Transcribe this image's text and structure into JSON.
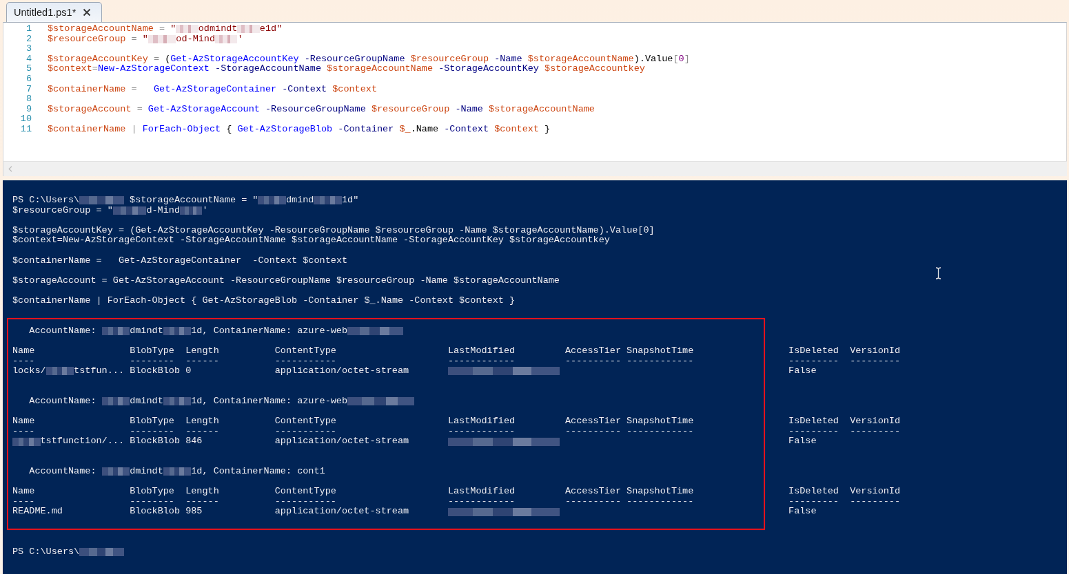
{
  "tabs": [
    {
      "label": "Untitled1.ps1*",
      "selected": true
    }
  ],
  "editor": {
    "lines": [
      {
        "number": "1",
        "tokens": [
          {
            "kind": "variable",
            "text": "$storageAccountName"
          },
          {
            "kind": "operator",
            "text": " = "
          },
          {
            "kind": "string",
            "text": "\""
          },
          {
            "kind": "redacted"
          },
          {
            "kind": "string",
            "text": "odmindt"
          },
          {
            "kind": "redacted"
          },
          {
            "kind": "string",
            "text": "e1d\""
          }
        ]
      },
      {
        "number": "2",
        "tokens": [
          {
            "kind": "variable",
            "text": "$resourceGroup"
          },
          {
            "kind": "operator",
            "text": " = "
          },
          {
            "kind": "string",
            "text": "\""
          },
          {
            "kind": "redacted"
          },
          {
            "kind": "string",
            "text": "od-Mind"
          },
          {
            "kind": "redacted"
          },
          {
            "kind": "string",
            "text": "'"
          }
        ]
      },
      {
        "number": "3"
      },
      {
        "number": "4",
        "tokens": [
          {
            "kind": "variable",
            "text": "$storageAccountKey"
          },
          {
            "kind": "operator",
            "text": " = "
          },
          {
            "kind": "plain",
            "text": "("
          },
          {
            "kind": "command",
            "text": "Get-AzStorageAccountKey"
          },
          {
            "kind": "parameter",
            "text": " -ResourceGroupName "
          },
          {
            "kind": "variable",
            "text": "$resourceGroup"
          },
          {
            "kind": "parameter",
            "text": " -Name "
          },
          {
            "kind": "variable",
            "text": "$storageAccountName"
          },
          {
            "kind": "plain",
            "text": ").Value"
          },
          {
            "kind": "operator",
            "text": "["
          },
          {
            "kind": "number",
            "text": "0"
          },
          {
            "kind": "operator",
            "text": "]"
          }
        ]
      },
      {
        "number": "5",
        "tokens": [
          {
            "kind": "variable",
            "text": "$context"
          },
          {
            "kind": "operator",
            "text": "="
          },
          {
            "kind": "command",
            "text": "New-AzStorageContext"
          },
          {
            "kind": "parameter",
            "text": " -StorageAccountName "
          },
          {
            "kind": "variable",
            "text": "$storageAccountName"
          },
          {
            "kind": "parameter",
            "text": " -StorageAccountKey "
          },
          {
            "kind": "variable",
            "text": "$storageAccountkey"
          }
        ]
      },
      {
        "number": "6"
      },
      {
        "number": "7",
        "tokens": [
          {
            "kind": "variable",
            "text": "$containerName"
          },
          {
            "kind": "operator",
            "text": " =   "
          },
          {
            "kind": "command",
            "text": "Get-AzStorageContainer"
          },
          {
            "kind": "parameter",
            "text": " -Context "
          },
          {
            "kind": "variable",
            "text": "$context"
          }
        ]
      },
      {
        "number": "8"
      },
      {
        "number": "9",
        "tokens": [
          {
            "kind": "variable",
            "text": "$storageAccount"
          },
          {
            "kind": "operator",
            "text": " = "
          },
          {
            "kind": "command",
            "text": "Get-AzStorageAccount"
          },
          {
            "kind": "parameter",
            "text": " -ResourceGroupName "
          },
          {
            "kind": "variable",
            "text": "$resourceGroup"
          },
          {
            "kind": "parameter",
            "text": " -Name "
          },
          {
            "kind": "variable",
            "text": "$storageAccountName"
          }
        ]
      },
      {
        "number": "10"
      },
      {
        "number": "11",
        "tokens": [
          {
            "kind": "variable",
            "text": "$containerName"
          },
          {
            "kind": "operator",
            "text": " | "
          },
          {
            "kind": "command",
            "text": "ForEach-Object"
          },
          {
            "kind": "plain",
            "text": " { "
          },
          {
            "kind": "command",
            "text": "Get-AzStorageBlob"
          },
          {
            "kind": "parameter",
            "text": " -Container "
          },
          {
            "kind": "variable",
            "text": "$_"
          },
          {
            "kind": "plain",
            "text": ".Name"
          },
          {
            "kind": "parameter",
            "text": " -Context "
          },
          {
            "kind": "variable",
            "text": "$context"
          },
          {
            "kind": "plain",
            "text": " }"
          }
        ]
      }
    ]
  },
  "console": {
    "input_blocks": [
      [
        [
          {
            "kind": "text",
            "text": "PS C:\\Users\\"
          },
          {
            "kind": "redacted"
          },
          {
            "kind": "text",
            "text": " $storageAccountName = \""
          },
          {
            "kind": "redacted"
          },
          {
            "kind": "text",
            "text": "dmind"
          },
          {
            "kind": "redacted"
          },
          {
            "kind": "text",
            "text": "1d\""
          }
        ],
        [
          {
            "kind": "text",
            "text": "$resourceGroup = \""
          },
          {
            "kind": "redacted"
          },
          {
            "kind": "text",
            "text": "d-Mind"
          },
          {
            "kind": "redacted"
          },
          {
            "kind": "text",
            "text": "'"
          }
        ]
      ],
      [
        [
          {
            "kind": "text",
            "text": "$storageAccountKey = (Get-AzStorageAccountKey -ResourceGroupName $resourceGroup -Name $storageAccountName).Value[0]"
          }
        ],
        [
          {
            "kind": "text",
            "text": "$context=New-AzStorageContext -StorageAccountName $storageAccountName -StorageAccountKey $storageAccountkey"
          }
        ]
      ],
      [
        [
          {
            "kind": "text",
            "text": "$containerName =   Get-AzStorageContainer  -Context $context"
          }
        ]
      ],
      [
        [
          {
            "kind": "text",
            "text": "$storageAccount = Get-AzStorageAccount -ResourceGroupName $resourceGroup -Name $storageAccountName"
          }
        ]
      ],
      [
        [
          {
            "kind": "text",
            "text": "$containerName | ForEach-Object { Get-AzStorageBlob -Container $_.Name -Context $context }"
          }
        ]
      ]
    ],
    "results": [
      {
        "account_line": [
          {
            "kind": "text",
            "text": "AccountName: "
          },
          {
            "kind": "redacted"
          },
          {
            "kind": "text",
            "text": "dmindt"
          },
          {
            "kind": "redacted"
          },
          {
            "kind": "text",
            "text": "1d, ContainerName: azure-web"
          },
          {
            "kind": "redacted"
          }
        ],
        "columns": [
          {
            "header": "Name",
            "rule": "----"
          },
          {
            "header": "BlobType",
            "rule": "--------"
          },
          {
            "header": "Length",
            "rule": "------"
          },
          {
            "header": "ContentType",
            "rule": "-----------"
          },
          {
            "header": "LastModified",
            "rule": "------------"
          },
          {
            "header": "AccessTier",
            "rule": "----------"
          },
          {
            "header": "SnapshotTime",
            "rule": "------------"
          },
          {
            "header": "IsDeleted",
            "rule": "---------"
          },
          {
            "header": "VersionId",
            "rule": "---------"
          }
        ],
        "row": {
          "name": [
            {
              "kind": "text",
              "text": "locks/"
            },
            {
              "kind": "redacted"
            },
            {
              "kind": "text",
              "text": "tstfun..."
            }
          ],
          "blob_type": "BlockBlob",
          "length": "0",
          "content_type": "application/octet-stream",
          "last_modified": [
            {
              "kind": "redacted"
            }
          ],
          "is_deleted": "False"
        }
      },
      {
        "account_line": [
          {
            "kind": "text",
            "text": "AccountName: "
          },
          {
            "kind": "redacted"
          },
          {
            "kind": "text",
            "text": "dmindt"
          },
          {
            "kind": "redacted"
          },
          {
            "kind": "text",
            "text": "1d, ContainerName: azure-web"
          },
          {
            "kind": "redacted"
          }
        ],
        "columns": [
          {
            "header": "Name",
            "rule": "----"
          },
          {
            "header": "BlobType",
            "rule": "--------"
          },
          {
            "header": "Length",
            "rule": "------"
          },
          {
            "header": "ContentType",
            "rule": "-----------"
          },
          {
            "header": "LastModified",
            "rule": "------------"
          },
          {
            "header": "AccessTier",
            "rule": "----------"
          },
          {
            "header": "SnapshotTime",
            "rule": "------------"
          },
          {
            "header": "IsDeleted",
            "rule": "---------"
          },
          {
            "header": "VersionId",
            "rule": "---------"
          }
        ],
        "row": {
          "name": [
            {
              "kind": "redacted"
            },
            {
              "kind": "text",
              "text": "tstfunction/..."
            }
          ],
          "blob_type": "BlockBlob",
          "length": "846",
          "content_type": "application/octet-stream",
          "last_modified": [
            {
              "kind": "redacted"
            }
          ],
          "is_deleted": "False"
        }
      },
      {
        "account_line": [
          {
            "kind": "text",
            "text": "AccountName: "
          },
          {
            "kind": "redacted"
          },
          {
            "kind": "text",
            "text": "dmindt"
          },
          {
            "kind": "redacted"
          },
          {
            "kind": "text",
            "text": "1d, ContainerName: cont1"
          }
        ],
        "columns": [
          {
            "header": "Name",
            "rule": "----"
          },
          {
            "header": "BlobType",
            "rule": "--------"
          },
          {
            "header": "Length",
            "rule": "------"
          },
          {
            "header": "ContentType",
            "rule": "-----------"
          },
          {
            "header": "LastModified",
            "rule": "------------"
          },
          {
            "header": "AccessTier",
            "rule": "----------"
          },
          {
            "header": "SnapshotTime",
            "rule": "------------"
          },
          {
            "header": "IsDeleted",
            "rule": "---------"
          },
          {
            "header": "VersionId",
            "rule": "---------"
          }
        ],
        "row": {
          "name": "README.md",
          "blob_type": "BlockBlob",
          "length": "985",
          "content_type": "application/octet-stream",
          "last_modified": [
            {
              "kind": "redacted"
            }
          ],
          "is_deleted": "False"
        }
      }
    ],
    "prompt": [
      {
        "kind": "text",
        "text": "PS C:\\Users\\"
      },
      {
        "kind": "redacted"
      }
    ]
  }
}
